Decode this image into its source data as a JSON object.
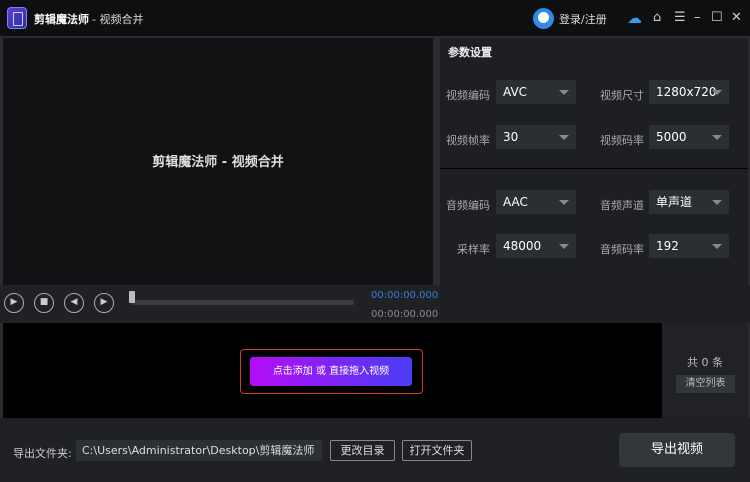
{
  "titlebar": {
    "app_name": "剪辑魔法师",
    "subtitle": "- 视频合并",
    "login": "登录/注册"
  },
  "preview": {
    "text": "剪辑魔法师 - 视频合并"
  },
  "settings": {
    "title": "参数设置",
    "video": [
      {
        "label": "视频编码",
        "value": "AVC"
      },
      {
        "label": "视频尺寸",
        "value": "1280x720"
      },
      {
        "label": "视频帧率",
        "value": "30"
      },
      {
        "label": "视频码率",
        "value": "5000"
      }
    ],
    "audio": [
      {
        "label": "音频编码",
        "value": "AAC"
      },
      {
        "label": "音频声道",
        "value": "单声道"
      },
      {
        "label": "采样率",
        "value": "48000"
      },
      {
        "label": "音频码率",
        "value": "192"
      }
    ]
  },
  "player": {
    "current_time": "00:00:00.000",
    "total_time": "00:00:00.000",
    "progress": 0
  },
  "list": {
    "add_label": "点击添加 或 直接拖入视频",
    "count": "共 0 条",
    "clear_label": "清空列表"
  },
  "footer": {
    "output_label": "导出文件夹:",
    "output_path": "C:\\Users\\Administrator\\Desktop\\剪辑魔法师",
    "change_dir": "更改目录",
    "open_folder": "打开文件夹",
    "export": "导出视频"
  }
}
